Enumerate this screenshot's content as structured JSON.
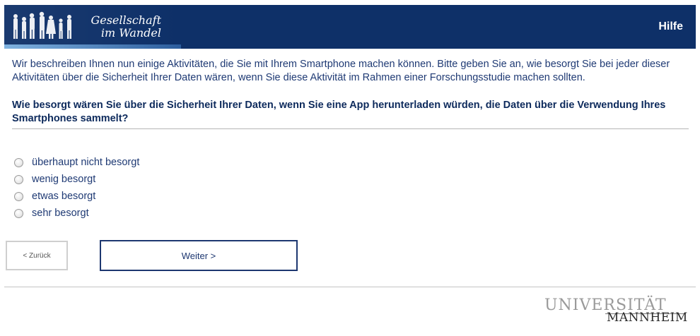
{
  "header": {
    "logo_line1": "Gesellschaft",
    "logo_line2": "im Wandel",
    "help_label": "Hilfe",
    "colors": {
      "bar": "#0e3068",
      "accent_stripe": "#7fb2e0"
    }
  },
  "intro_text": "Wir beschreiben Ihnen nun einige Aktivitäten, die Sie mit Ihrem Smartphone machen können. Bitte geben Sie an, wie besorgt Sie bei jeder dieser Aktivitäten über die Sicherheit Ihrer Daten wären, wenn Sie diese Aktivität im Rahmen einer Forschungsstudie machen sollten.",
  "question_text": "Wie besorgt wären Sie über die Sicherheit Ihrer Daten, wenn Sie eine App herunterladen würden, die Daten über die Verwendung Ihres Smartphones sammelt?",
  "options": [
    {
      "label": "überhaupt nicht besorgt",
      "selected": false
    },
    {
      "label": "wenig besorgt",
      "selected": false
    },
    {
      "label": "etwas besorgt",
      "selected": false
    },
    {
      "label": "sehr besorgt",
      "selected": false
    }
  ],
  "nav": {
    "back_label": "< Zurück",
    "next_label": "Weiter >"
  },
  "footer": {
    "uni_top": "UNIVERSITÄT",
    "uni_bottom": "MANNHEIM"
  }
}
